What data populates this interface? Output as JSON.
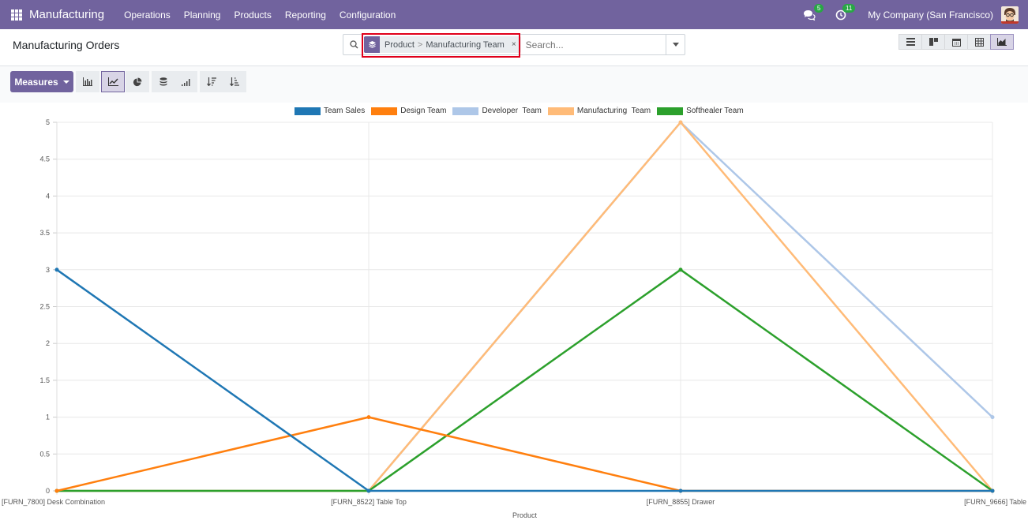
{
  "navbar": {
    "app_name": "Manufacturing",
    "menu": [
      "Operations",
      "Planning",
      "Products",
      "Reporting",
      "Configuration"
    ],
    "messages_count": "5",
    "activities_count": "11",
    "company": "My Company (San Francisco)"
  },
  "control": {
    "title": "Manufacturing Orders",
    "facet": {
      "first": "Product",
      "separator": ">",
      "second": "Manufacturing Team",
      "remove": "×"
    },
    "search_placeholder": "Search...",
    "views": [
      "list-icon",
      "kanban-icon",
      "calendar-icon",
      "pivot-icon",
      "graph-icon"
    ],
    "active_view": "graph-icon"
  },
  "toolbar": {
    "measures_label": "Measures",
    "buttons": [
      "bar-chart-icon",
      "line-chart-icon",
      "pie-chart-icon",
      "stacked-icon",
      "cumulative-icon",
      "sort-descending-icon",
      "sort-ascending-icon"
    ],
    "active_chart": "line-chart-icon"
  },
  "colors": {
    "accent": "#71639e",
    "series": [
      "#1f77b4",
      "#ff7f0e",
      "#aec7e8",
      "#ffbb78",
      "#2ca02c"
    ]
  },
  "chart_data": {
    "type": "line",
    "xlabel": "Product",
    "ylabel": "",
    "ylim": [
      0,
      5
    ],
    "yticks": [
      "0",
      "0.5",
      "1",
      "1.5",
      "2",
      "2.5",
      "3",
      "3.5",
      "4",
      "4.5",
      "5"
    ],
    "grid": true,
    "legend": "top-center",
    "categories": [
      "[FURN_7800] Desk Combination",
      "[FURN_8522] Table Top",
      "[FURN_8855] Drawer",
      "[FURN_9666] Table"
    ],
    "series": [
      {
        "name": "Team Sales",
        "values": [
          3,
          0,
          0,
          0
        ]
      },
      {
        "name": "Design Team",
        "values": [
          0,
          1,
          0,
          0
        ]
      },
      {
        "name": "Developer  Team",
        "values": [
          0,
          0,
          5,
          1
        ]
      },
      {
        "name": "Manufacturing  Team",
        "values": [
          0,
          0,
          5,
          0
        ]
      },
      {
        "name": "Softhealer Team",
        "values": [
          0,
          0,
          3,
          0
        ]
      }
    ]
  }
}
